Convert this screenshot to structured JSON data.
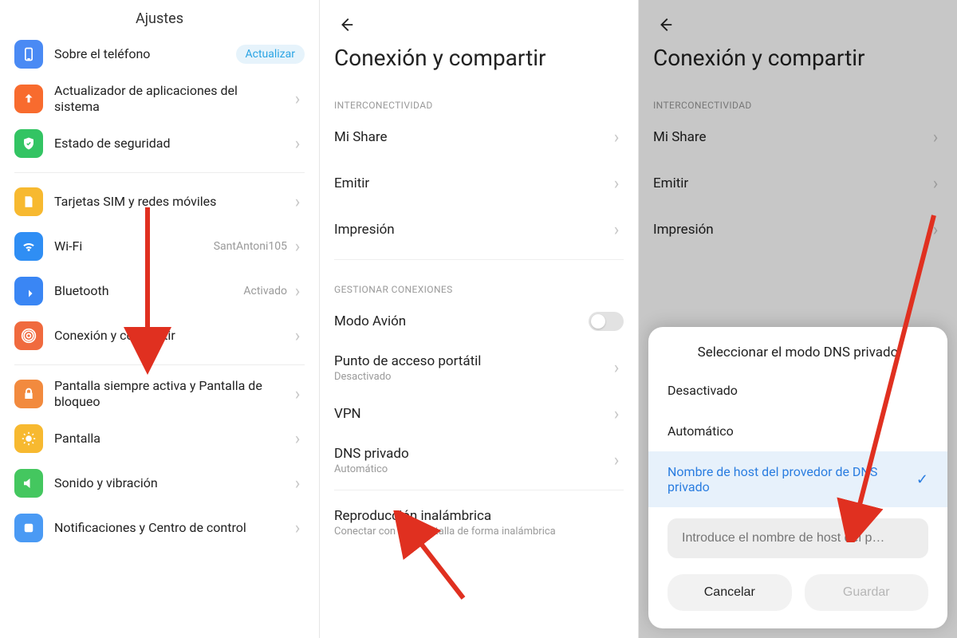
{
  "pane1": {
    "header": "Ajustes",
    "items": {
      "about": {
        "label": "Sobre el teléfono",
        "badge": "Actualizar"
      },
      "updater": {
        "label": "Actualizador de aplicaciones del sistema"
      },
      "security": {
        "label": "Estado de seguridad"
      },
      "sim": {
        "label": "Tarjetas SIM y redes móviles"
      },
      "wifi": {
        "label": "Wi-Fi",
        "value": "SantAntoni105"
      },
      "bt": {
        "label": "Bluetooth",
        "value": "Activado"
      },
      "conn": {
        "label": "Conexión y compartir"
      },
      "lock": {
        "label": "Pantalla siempre activa y Pantalla de bloqueo"
      },
      "display": {
        "label": "Pantalla"
      },
      "sound": {
        "label": "Sonido y vibración"
      },
      "notif": {
        "label": "Notificaciones y Centro de control"
      }
    }
  },
  "pane2": {
    "title": "Conexión y compartir",
    "sect1": "INTERCONECTIVIDAD",
    "mishare": {
      "label": "Mi Share"
    },
    "cast": {
      "label": "Emitir"
    },
    "print": {
      "label": "Impresión"
    },
    "sect2": "GESTIONAR CONEXIONES",
    "airplane": {
      "label": "Modo Avión"
    },
    "hotspot": {
      "label": "Punto de acceso portátil",
      "sub": "Desactivado"
    },
    "vpn": {
      "label": "VPN"
    },
    "dns": {
      "label": "DNS privado",
      "sub": "Automático"
    },
    "wireless": {
      "label": "Reproducción inalámbrica",
      "sub": "Conectar con una pantalla de forma inalámbrica"
    }
  },
  "pane3": {
    "title": "Conexión y compartir",
    "sect1": "INTERCONECTIVIDAD",
    "mishare": {
      "label": "Mi Share"
    },
    "cast": {
      "label": "Emitir"
    },
    "print": {
      "label": "Impresión"
    },
    "modal": {
      "title": "Seleccionar el modo DNS privado",
      "opt_off": "Desactivado",
      "opt_auto": "Automático",
      "opt_host": "Nombre de host del provedor de DNS privado",
      "placeholder": "Introduce el nombre de host del p…",
      "cancel": "Cancelar",
      "save": "Guardar"
    }
  }
}
